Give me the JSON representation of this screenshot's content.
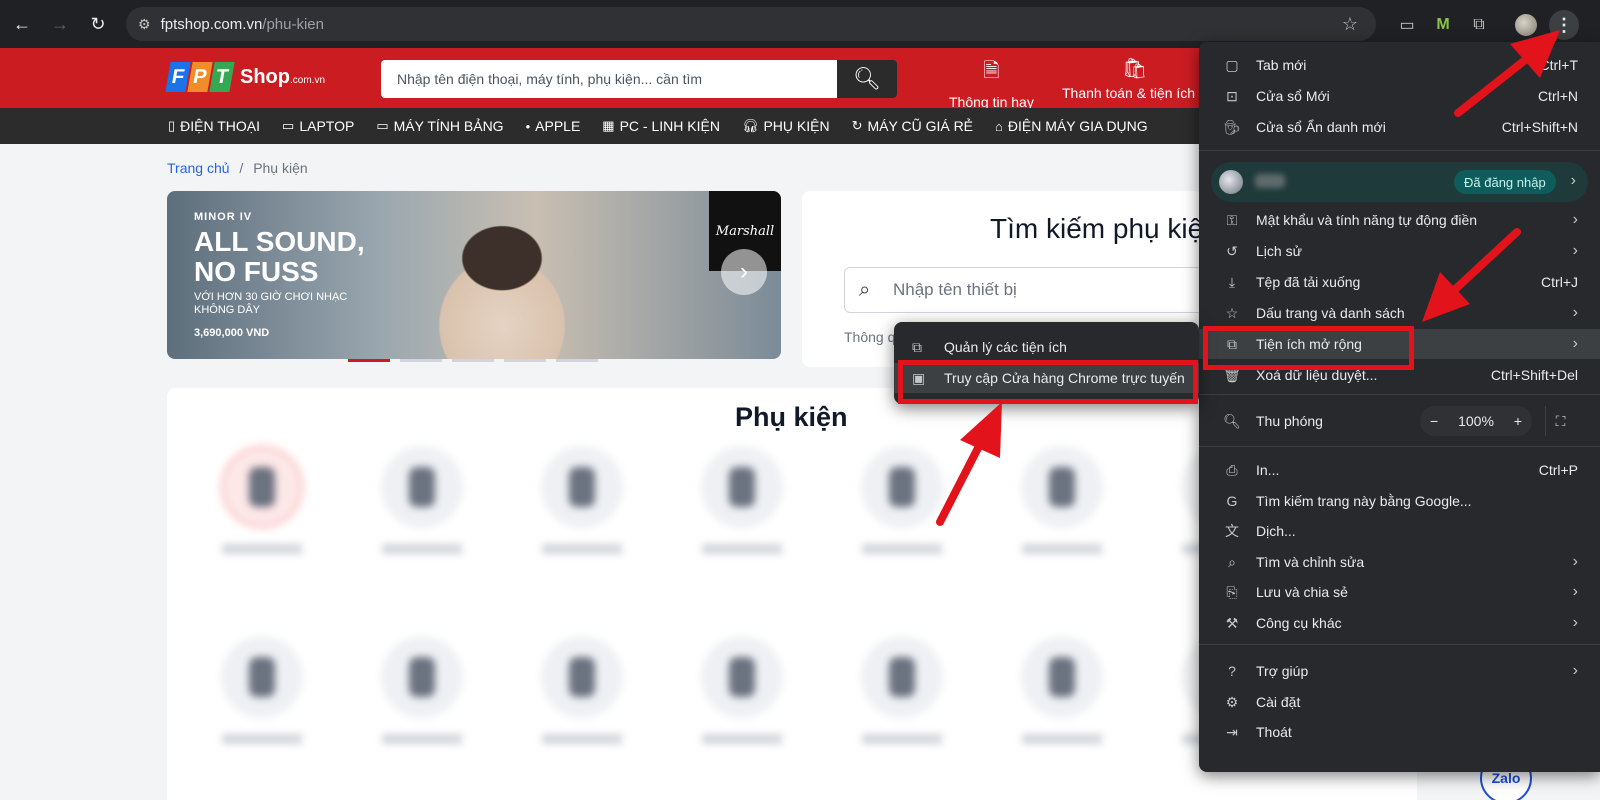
{
  "browser": {
    "url_host": "fptshop.com.vn",
    "url_path": "/phu-kien"
  },
  "header": {
    "logo_letters": [
      "F",
      "P",
      "T"
    ],
    "logo_colors": [
      "#1a73e8",
      "#f28c28",
      "#34a853"
    ],
    "logo_shop": "Shop",
    "logo_domain": ".com.vn",
    "search_placeholder": "Nhập tên điện thoại, máy tính, phụ kiện... cần tìm",
    "links": [
      {
        "label": "Thông tin hay",
        "icon": "document-icon"
      },
      {
        "label": "Thanh toán & tiện ích",
        "icon": "payment-icon"
      }
    ]
  },
  "categories": [
    {
      "label": "ĐIỆN THOẠI",
      "icon": "phone-icon"
    },
    {
      "label": "LAPTOP",
      "icon": "laptop-icon"
    },
    {
      "label": "MÁY TÍNH BẢNG",
      "icon": "tablet-icon"
    },
    {
      "label": "APPLE",
      "icon": "apple-icon"
    },
    {
      "label": "PC - LINH KIỆN",
      "icon": "pc-icon"
    },
    {
      "label": "PHỤ KIỆN",
      "icon": "headphones-icon"
    },
    {
      "label": "MÁY CŨ GIÁ RẺ",
      "icon": "refresh-icon"
    },
    {
      "label": "ĐIỆN MÁY GIA DỤNG",
      "icon": "house-icon"
    }
  ],
  "breadcrumb": {
    "home": "Trang chủ",
    "sep": "/",
    "current": "Phụ kiện"
  },
  "banner": {
    "tagline": "MINOR IV",
    "headline": "ALL SOUND, NO FUSS",
    "sub": "VỚI HƠN 30 GIỜ CHƠI NHẠC KHÔNG DÂY",
    "price": "3,690,000 VND",
    "brand": "Marshall",
    "slides": 5,
    "active_slide": 1
  },
  "search_card": {
    "title": "Tìm kiếm phụ kiện",
    "placeholder": "Nhập tên thiết bị",
    "hint": "Thông qua"
  },
  "accessories": {
    "title": "Phụ kiện"
  },
  "zalo": "Zalo",
  "chrome_menu": {
    "items_top": [
      {
        "label": "Tab mới",
        "shortcut": "Ctrl+T",
        "icon": "new-tab-icon"
      },
      {
        "label": "Cửa sổ Mới",
        "shortcut": "Ctrl+N",
        "icon": "new-window-icon"
      },
      {
        "label": "Cửa sổ Ẩn danh mới",
        "shortcut": "Ctrl+Shift+N",
        "icon": "incognito-icon"
      }
    ],
    "profile_badge": "Đã đăng nhập",
    "items_mid": [
      {
        "label": "Mật khẩu và tính năng tự động điền",
        "shortcut": "",
        "icon": "key-icon",
        "submenu": true
      },
      {
        "label": "Lịch sử",
        "shortcut": "",
        "icon": "history-icon",
        "submenu": true
      },
      {
        "label": "Tệp đã tải xuống",
        "shortcut": "Ctrl+J",
        "icon": "download-icon",
        "submenu": false
      },
      {
        "label": "Dấu trang và danh sách",
        "shortcut": "",
        "icon": "star-icon",
        "submenu": true
      },
      {
        "label": "Tiện ích mở rộng",
        "shortcut": "",
        "icon": "puzzle-icon",
        "submenu": true
      },
      {
        "label": "Xoá dữ liệu duyệt...",
        "shortcut": "Ctrl+Shift+Del",
        "icon": "trash-icon",
        "submenu": false
      }
    ],
    "zoom": {
      "label": "Thu phóng",
      "minus": "−",
      "value": "100%",
      "plus": "+"
    },
    "items_bottom": [
      {
        "label": "In...",
        "shortcut": "Ctrl+P",
        "icon": "print-icon",
        "submenu": false
      },
      {
        "label": "Tìm kiếm trang này bằng Google...",
        "shortcut": "",
        "icon": "google-icon",
        "submenu": false
      },
      {
        "label": "Dịch...",
        "shortcut": "",
        "icon": "translate-icon",
        "submenu": false
      },
      {
        "label": "Tìm và chỉnh sửa",
        "shortcut": "",
        "icon": "find-icon",
        "submenu": true
      },
      {
        "label": "Lưu và chia sẻ",
        "shortcut": "",
        "icon": "save-share-icon",
        "submenu": true
      },
      {
        "label": "Công cụ khác",
        "shortcut": "",
        "icon": "toolbox-icon",
        "submenu": true
      }
    ],
    "items_end": [
      {
        "label": "Trợ giúp",
        "shortcut": "",
        "icon": "help-icon",
        "submenu": true
      },
      {
        "label": "Cài đặt",
        "shortcut": "",
        "icon": "settings-icon",
        "submenu": false
      },
      {
        "label": "Thoát",
        "shortcut": "",
        "icon": "exit-icon",
        "submenu": false
      }
    ]
  },
  "submenu": {
    "items": [
      {
        "label": "Quản lý các tiện ích",
        "icon": "puzzle-icon"
      },
      {
        "label": "Truy cập Cửa hàng Chrome trực tuyến",
        "icon": "web-store-icon"
      }
    ]
  },
  "colors": {
    "brand_red": "#cb1c22",
    "highlight_red": "#e3131b",
    "menu_bg": "#28292c"
  }
}
